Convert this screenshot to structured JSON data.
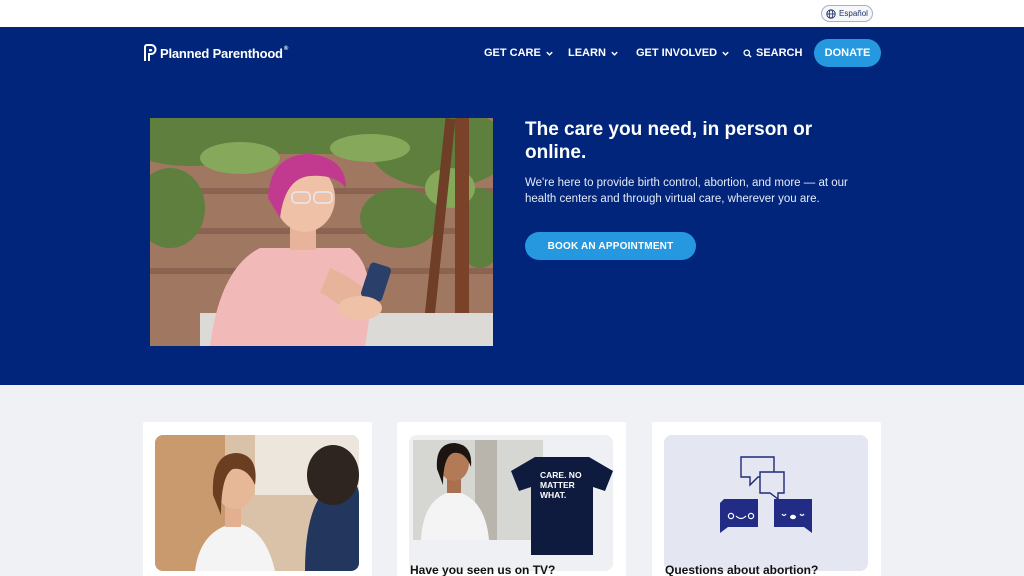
{
  "utility": {
    "language_label": "Español"
  },
  "header": {
    "brand": "Planned Parenthood",
    "brand_mark": "®",
    "nav": {
      "get_care": "GET CARE",
      "learn": "LEARN",
      "get_involved": "GET INVOLVED",
      "search": "SEARCH",
      "donate": "DONATE"
    }
  },
  "hero": {
    "title": "The care you need, in person or online.",
    "subtitle": "We're here to provide birth control, abortion, and more — at our health centers and through virtual care, wherever you are.",
    "cta": "BOOK AN APPOINTMENT"
  },
  "cards": [
    {
      "title": ""
    },
    {
      "title": "Have you seen us on TV?",
      "shirt_text": "CARE. NO MATTER WHAT."
    },
    {
      "title": "Questions about abortion?"
    }
  ],
  "colors": {
    "navy": "#00257a",
    "accent_blue": "#2598e0",
    "page_bg": "#eff1f5"
  }
}
